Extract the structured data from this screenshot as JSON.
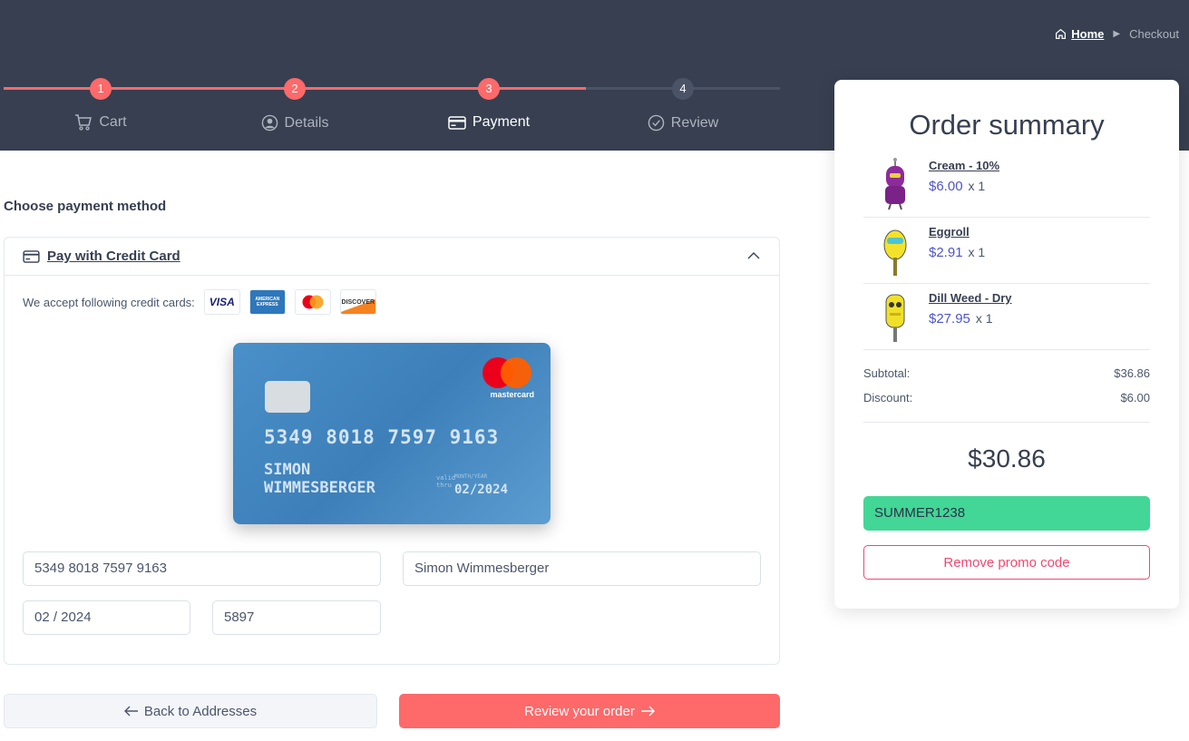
{
  "breadcrumb": {
    "home": "Home",
    "current": "Checkout"
  },
  "steps": [
    {
      "num": "1",
      "label": "Cart",
      "icon": "cart-icon"
    },
    {
      "num": "2",
      "label": "Details",
      "icon": "user-circle-icon"
    },
    {
      "num": "3",
      "label": "Payment",
      "icon": "credit-card-icon"
    },
    {
      "num": "4",
      "label": "Review",
      "icon": "check-circle-icon"
    }
  ],
  "main": {
    "section_title": "Choose payment method",
    "panel_title": "Pay with Credit Card",
    "accept_text": "We accept following credit cards:",
    "card_logos": [
      "VISA",
      "AMERICAN EXPRESS",
      "mastercard",
      "DISCOVER"
    ]
  },
  "card_preview": {
    "brand": "mastercard",
    "number": "5349 8018 7597 9163",
    "name_line1": "SIMON",
    "name_line2": "WIMMESBERGER",
    "month_year_label": "MONTH/YEAR",
    "valid_label_1": "valid",
    "valid_label_2": "thru",
    "expiry": "02/2024"
  },
  "form": {
    "card_number": "5349 8018 7597 9163",
    "card_name": "Simon Wimmesberger",
    "expiry": "02 / 2024",
    "cvc": "5897"
  },
  "buttons": {
    "back": "Back to Addresses",
    "review": "Review your order"
  },
  "summary": {
    "title": "Order summary",
    "items": [
      {
        "name": "Cream - 10%",
        "price": "$6.00",
        "qty": "x 1"
      },
      {
        "name": "Eggroll",
        "price": "$2.91",
        "qty": "x 1"
      },
      {
        "name": "Dill Weed - Dry",
        "price": "$27.95",
        "qty": "x 1"
      }
    ],
    "subtotal_label": "Subtotal:",
    "subtotal": "$36.86",
    "discount_label": "Discount:",
    "discount": "$6.00",
    "total": "$30.86",
    "promo_code": "SUMMER1238",
    "remove_promo": "Remove promo code"
  },
  "colors": {
    "header_bg": "#373f50",
    "accent": "#fe696a",
    "price": "#4e54c8",
    "promo_bg": "#42d697",
    "danger": "#f34770"
  }
}
